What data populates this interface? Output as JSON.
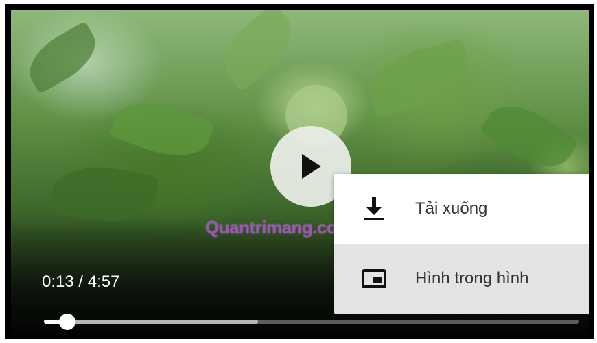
{
  "player": {
    "current_time": "0:13",
    "separator": " / ",
    "duration": "4:57",
    "played_fraction": 0.044,
    "buffered_fraction": 0.4
  },
  "watermark": "Quantrimang.com",
  "context_menu": {
    "items": [
      {
        "label": "Tải xuống",
        "icon": "download-icon",
        "highlighted": false
      },
      {
        "label": "Hình trong hình",
        "icon": "picture-in-picture-icon",
        "highlighted": true
      }
    ]
  },
  "colors": {
    "watermark": "#a44fc0",
    "menu_highlight": "#e3e3e3",
    "menu_text": "#333333"
  }
}
